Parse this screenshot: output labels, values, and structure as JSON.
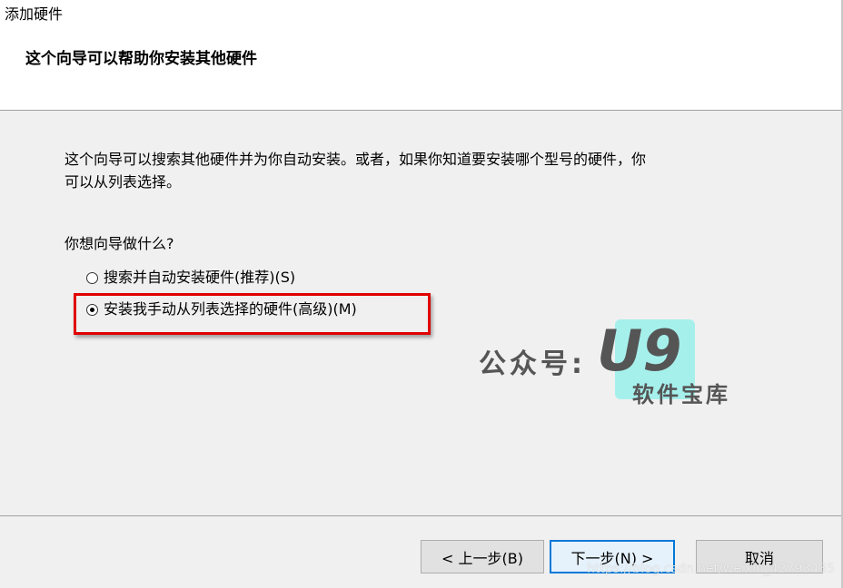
{
  "window": {
    "title": "添加硬件"
  },
  "wizard": {
    "heading": "这个向导可以帮助你安装其他硬件"
  },
  "content": {
    "intro_line1": "这个向导可以搜索其他硬件并为你自动安装。或者，如果你知道要安装哪个型号的硬件，你",
    "intro_line2": "可以从列表选择。",
    "question": "你想向导做什么?",
    "options": [
      {
        "label": "搜索并自动安装硬件(推荐)(S)",
        "selected": false
      },
      {
        "label": "安装我手动从列表选择的硬件(高级)(M)",
        "selected": true
      }
    ],
    "highlight_color": "#e00000"
  },
  "buttons": {
    "back": "< 上一步(B)",
    "next": "下一步(N) >",
    "cancel": "取消"
  },
  "watermark": {
    "label": "公众号:",
    "logo": "U9",
    "sub": "软件宝库",
    "logo_bg": "#a6f0ec",
    "url": "https://blog.csdn.net/weixin_42793435"
  }
}
